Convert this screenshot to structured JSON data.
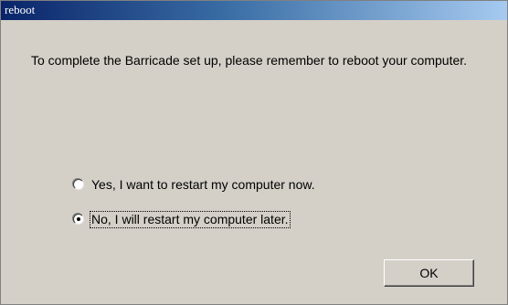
{
  "window": {
    "title": "reboot"
  },
  "message": "To complete the Barricade set up, please remember to reboot your computer.",
  "options": [
    {
      "label": "Yes, I want to restart my computer now.",
      "selected": false
    },
    {
      "label": "No, I will restart my computer later.",
      "selected": true
    }
  ],
  "buttons": {
    "ok_label": "OK"
  },
  "colors": {
    "dialog_background": "#d4d0c8",
    "titlebar_start": "#0a246a",
    "titlebar_end": "#a6caf0",
    "title_text": "#ffffff"
  }
}
